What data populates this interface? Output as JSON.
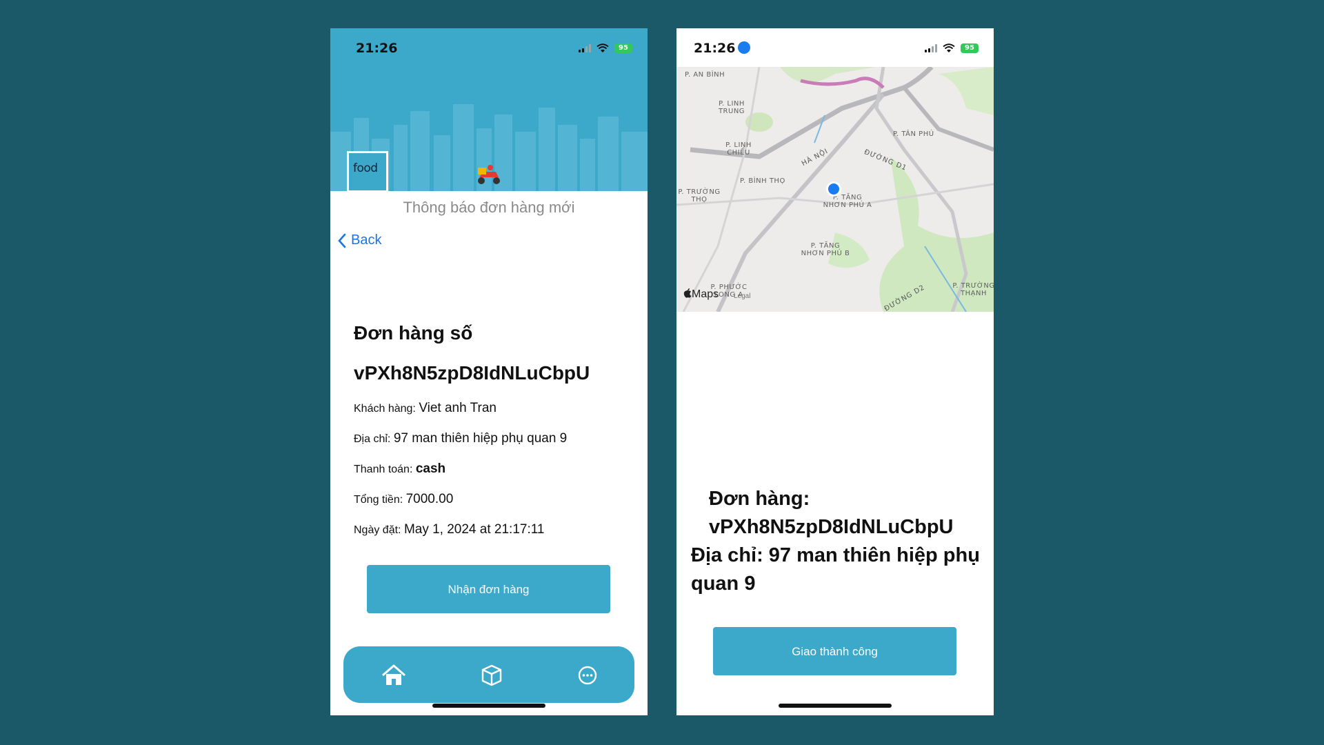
{
  "left_screen": {
    "status": {
      "time": "21:26",
      "battery": "95"
    },
    "header": {
      "logo_text": "food",
      "title": "Thông báo đơn hàng mới"
    },
    "back_label": "Back",
    "order": {
      "heading": "Đơn hàng số",
      "id": "vPXh8N5zpD8IdNLuCbpU",
      "fields": [
        {
          "label": "Khách hàng:",
          "value": "Viet anh Tran"
        },
        {
          "label": "Địa chỉ:",
          "value": "97 man thiên hiệp phụ quan 9"
        },
        {
          "label": "Thanh toán:",
          "value": "cash"
        },
        {
          "label": "Tổng tiền:",
          "value": "7000.00"
        },
        {
          "label": "Ngày đặt:",
          "value": "May 1, 2024 at 21:17:11"
        }
      ]
    },
    "accept_button": "Nhận đơn hàng",
    "tabbar": [
      "home-icon",
      "box-icon",
      "more-icon"
    ]
  },
  "right_screen": {
    "status": {
      "time": "21:26",
      "battery": "95"
    },
    "map": {
      "labels": [
        "P. AN BÌNH",
        "P. LINH TRUNG",
        "P. LINH CHIỂU",
        "P. TÂN PHÚ",
        "P. BÌNH THỌ",
        "P. TRƯỜNG THỌ",
        "P. TĂNG NHƠN PHÚ A",
        "P. TĂNG NHƠN PHÚ B",
        "P. PHƯỚC LONG A",
        "P. TRƯỜNG THẠNH"
      ],
      "roads": [
        "HÀ NỘI",
        "ĐƯỜNG D1",
        "ĐƯỜNG D2"
      ],
      "brand": "Maps",
      "legal": "Legal"
    },
    "delivery": {
      "order_line": "Đơn hàng:",
      "order_id": "vPXh8N5zpD8IdNLuCbpU",
      "address_line": "Địa chỉ: 97 man thiên hiệp phụ quan 9"
    },
    "delivered_button": "Giao thành công"
  },
  "colors": {
    "background": "#1b5868",
    "accent": "#3ca9cb",
    "link": "#1a73e8"
  }
}
